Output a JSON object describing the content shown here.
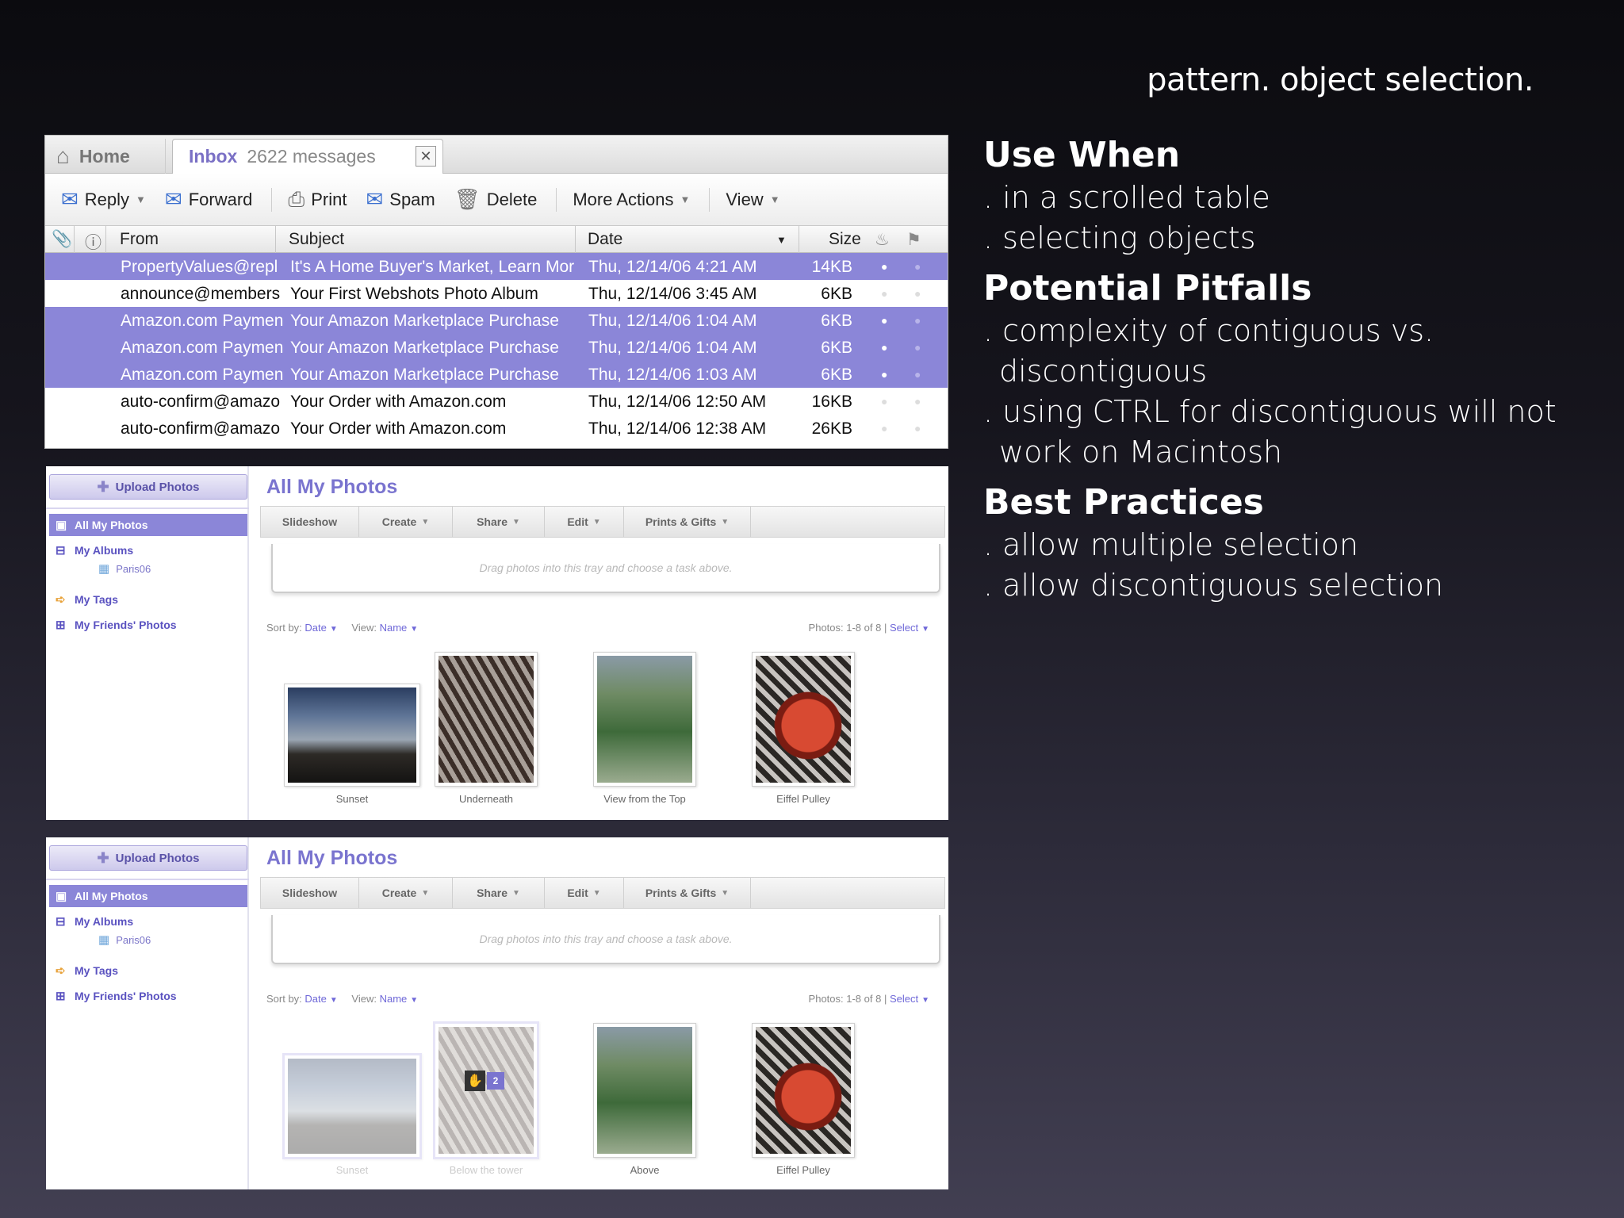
{
  "slide": {
    "title": "pattern. object selection."
  },
  "notes": {
    "sections": [
      {
        "heading": "Use When",
        "items": [
          "in a scrolled table",
          "selecting objects"
        ]
      },
      {
        "heading": "Potential Pitfalls",
        "items": [
          "complexity of contiguous vs. discontiguous",
          "using CTRL for discontiguous will not work on Macintosh"
        ]
      },
      {
        "heading": "Best Practices",
        "items": [
          "allow multiple selection",
          "allow discontiguous selection"
        ]
      }
    ]
  },
  "mail": {
    "tabs": {
      "home": "Home",
      "inbox": "Inbox",
      "inbox_count": "2622 messages"
    },
    "toolbar": {
      "reply": "Reply",
      "forward": "Forward",
      "print": "Print",
      "spam": "Spam",
      "delete": "Delete",
      "more_actions": "More Actions",
      "view": "View"
    },
    "columns": {
      "from": "From",
      "subject": "Subject",
      "date": "Date",
      "size": "Size"
    },
    "rows": [
      {
        "from": "PropertyValues@repl",
        "subject": "It's A Home Buyer's Market, Learn Mor",
        "date": "Thu, 12/14/06 4:21 AM",
        "size": "14KB",
        "selected": true
      },
      {
        "from": "announce@members",
        "subject": "Your First Webshots Photo Album",
        "date": "Thu, 12/14/06 3:45 AM",
        "size": "6KB",
        "selected": false
      },
      {
        "from": "Amazon.com Paymen",
        "subject": "Your Amazon Marketplace Purchase",
        "date": "Thu, 12/14/06 1:04 AM",
        "size": "6KB",
        "selected": true
      },
      {
        "from": "Amazon.com Paymen",
        "subject": "Your Amazon Marketplace Purchase",
        "date": "Thu, 12/14/06 1:04 AM",
        "size": "6KB",
        "selected": true
      },
      {
        "from": "Amazon.com Paymen",
        "subject": "Your Amazon Marketplace Purchase",
        "date": "Thu, 12/14/06 1:03 AM",
        "size": "6KB",
        "selected": true
      },
      {
        "from": "auto-confirm@amazo",
        "subject": "Your Order with Amazon.com",
        "date": "Thu, 12/14/06 12:50 AM",
        "size": "16KB",
        "selected": false
      },
      {
        "from": "auto-confirm@amazo",
        "subject": "Your Order with Amazon.com",
        "date": "Thu, 12/14/06 12:38 AM",
        "size": "26KB",
        "selected": false
      }
    ]
  },
  "photos1": {
    "upload": "Upload Photos",
    "sidebar": {
      "all": "All My Photos",
      "albums": "My Albums",
      "album_sub": "Paris06",
      "tags": "My Tags",
      "friends": "My Friends' Photos"
    },
    "title": "All My Photos",
    "toolbar": {
      "slideshow": "Slideshow",
      "create": "Create",
      "share": "Share",
      "edit": "Edit",
      "prints": "Prints & Gifts"
    },
    "tray": "Drag photos into this tray and choose a task above.",
    "sort_label": "Sort by:",
    "sort_value": "Date",
    "view_label": "View:",
    "view_value": "Name",
    "count": "Photos: 1-8 of 8",
    "select": "Select",
    "captions": [
      "Sunset",
      "Underneath",
      "View from the Top",
      "Eiffel Pulley"
    ]
  },
  "photos2": {
    "upload": "Upload Photos",
    "sidebar": {
      "all": "All My Photos",
      "albums": "My Albums",
      "album_sub": "Paris06",
      "tags": "My Tags",
      "friends": "My Friends' Photos"
    },
    "title": "All My Photos",
    "toolbar": {
      "slideshow": "Slideshow",
      "create": "Create",
      "share": "Share",
      "edit": "Edit",
      "prints": "Prints & Gifts"
    },
    "tray": "Drag photos into this tray and choose a task above.",
    "sort_label": "Sort by:",
    "sort_value": "Date",
    "view_label": "View:",
    "view_value": "Name",
    "count": "Photos: 1-8 of 8",
    "select": "Select",
    "drag_count": "2",
    "captions": [
      "Sunset",
      "Below the tower",
      "Above",
      "Eiffel Pulley"
    ]
  }
}
